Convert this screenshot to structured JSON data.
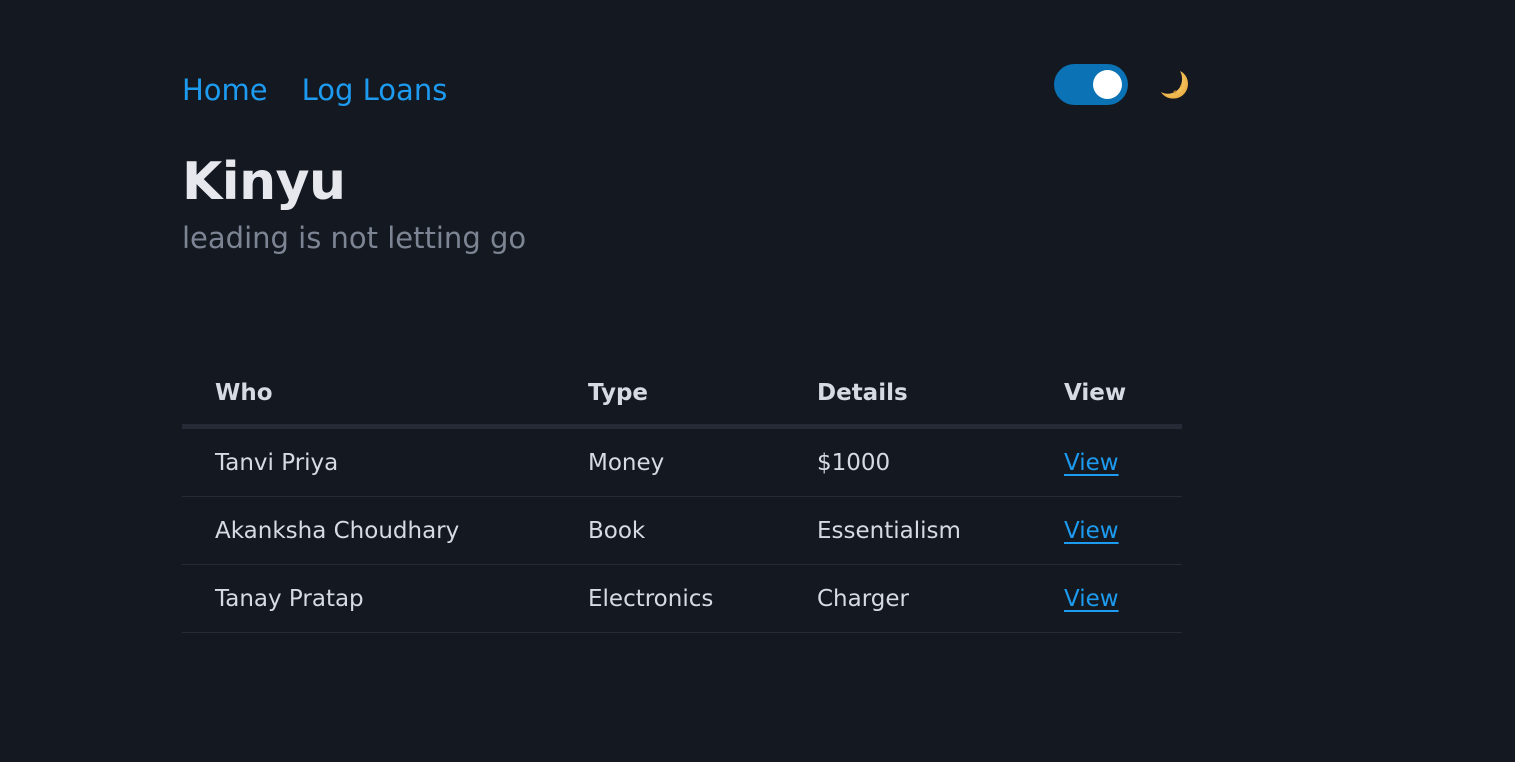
{
  "nav": {
    "links": [
      {
        "label": "Home"
      },
      {
        "label": "Log Loans"
      }
    ]
  },
  "theme": {
    "toggle_on": true,
    "mode_icon": "crescent-moon-icon"
  },
  "header": {
    "title": "Kinyu",
    "subtitle": "leading is not letting go"
  },
  "table": {
    "columns": [
      "Who",
      "Type",
      "Details",
      "View"
    ],
    "rows": [
      {
        "who": "Tanvi Priya",
        "type": "Money",
        "details": "$1000",
        "view": "View"
      },
      {
        "who": "Akanksha Choudhary",
        "type": "Book",
        "details": "Essentialism",
        "view": "View"
      },
      {
        "who": "Tanay Pratap",
        "type": "Electronics",
        "details": "Charger",
        "view": "View"
      }
    ]
  },
  "colors": {
    "background": "#141820",
    "link": "#1d9bf0",
    "toggle": "#0a72b5",
    "text": "#d6dae2",
    "muted": "#7d8594"
  }
}
